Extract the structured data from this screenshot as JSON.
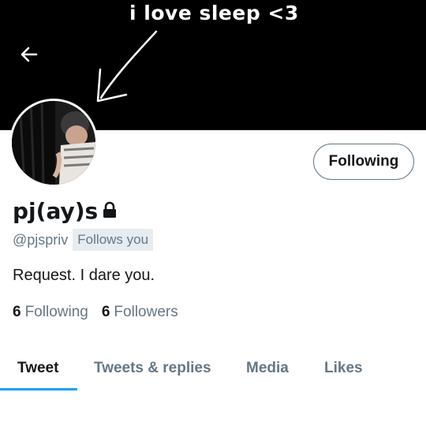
{
  "banner": {
    "caption": "i love sleep <3"
  },
  "profile": {
    "display_name": "pj(ay)s",
    "handle": "@pjspriv",
    "follows_you_badge": "Follows you",
    "bio": "Request. I dare you.",
    "following_count": "6",
    "following_label": "Following",
    "followers_count": "6",
    "followers_label": "Followers"
  },
  "actions": {
    "follow_button_label": "Following"
  },
  "tabs": [
    {
      "label": "Tweet",
      "active": true
    },
    {
      "label": "Tweets & replies",
      "active": false
    },
    {
      "label": "Media",
      "active": false
    },
    {
      "label": "Likes",
      "active": false
    }
  ],
  "icons": {
    "back": "back-arrow-icon",
    "lock": "lock-icon"
  },
  "colors": {
    "accent": "#1da1f2",
    "banner_bg": "#000000",
    "secondary_text": "#657786",
    "badge_bg": "#e6ecf0"
  }
}
